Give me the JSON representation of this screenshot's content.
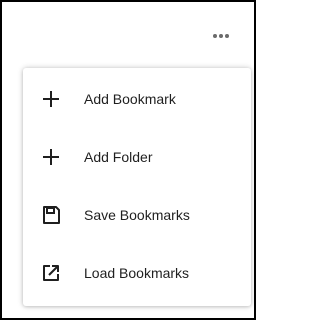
{
  "toolbar": {
    "more_icon": "more-horizontal-icon"
  },
  "menu": {
    "items": [
      {
        "label": "Add Bookmark",
        "icon": "plus-icon"
      },
      {
        "label": "Add Folder",
        "icon": "plus-icon"
      },
      {
        "label": "Save Bookmarks",
        "icon": "save-icon"
      },
      {
        "label": "Load Bookmarks",
        "icon": "open-external-icon"
      }
    ]
  },
  "colors": {
    "frame_border": "#000000",
    "text": "#1f1f1f",
    "icon": "#1f1f1f",
    "dots": "#6b6b6b"
  }
}
